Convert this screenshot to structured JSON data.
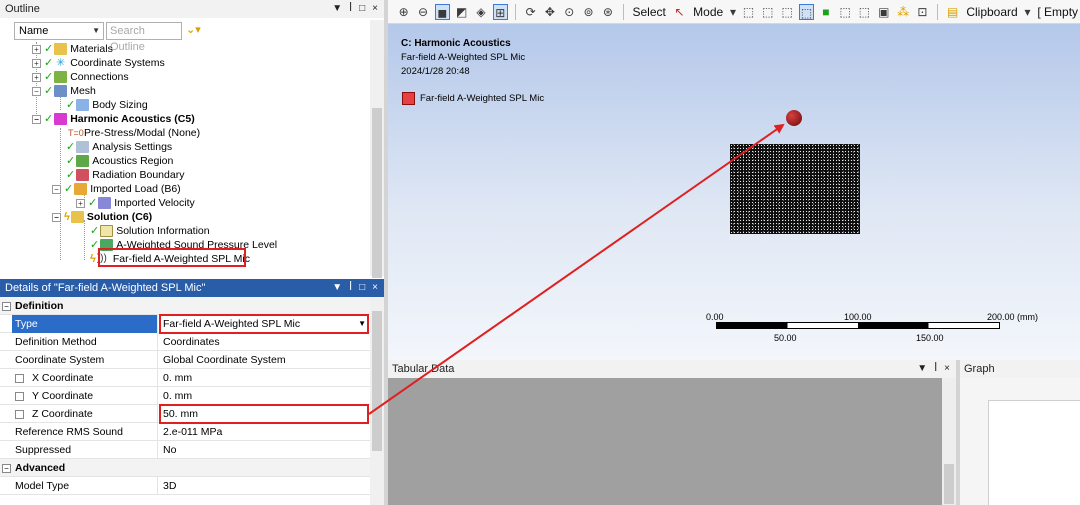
{
  "colors": {
    "accent": "#2a5da8",
    "selection": "#2a6cc8",
    "annotation": "#e02020",
    "ok_check": "#18a318"
  },
  "outline": {
    "title": "Outline",
    "name_select": "Name",
    "search_placeholder": "Search Outline",
    "tree": [
      {
        "label": "Materials",
        "icon": "materials-icon"
      },
      {
        "label": "Coordinate Systems",
        "icon": "coordinate-systems-icon"
      },
      {
        "label": "Connections",
        "icon": "connections-icon"
      },
      {
        "label": "Mesh",
        "icon": "mesh-icon"
      },
      {
        "label": "Body Sizing",
        "icon": "body-sizing-icon"
      },
      {
        "label": "Harmonic Acoustics (C5)",
        "icon": "harmonic-acoustics-icon"
      },
      {
        "label": "Pre-Stress/Modal (None)",
        "icon": "pre-stress-icon"
      },
      {
        "label": "Analysis Settings",
        "icon": "analysis-settings-icon"
      },
      {
        "label": "Acoustics Region",
        "icon": "acoustics-region-icon"
      },
      {
        "label": "Radiation Boundary",
        "icon": "radiation-boundary-icon"
      },
      {
        "label": "Imported Load (B6)",
        "icon": "imported-load-icon"
      },
      {
        "label": "Imported Velocity",
        "icon": "imported-velocity-icon"
      },
      {
        "label": "Solution (C6)",
        "icon": "solution-icon"
      },
      {
        "label": "Solution Information",
        "icon": "solution-information-icon"
      },
      {
        "label": "A-Weighted Sound Pressure Level",
        "icon": "sound-pressure-icon"
      },
      {
        "label": "Far-field A-Weighted SPL Mic",
        "icon": "mic-icon"
      }
    ]
  },
  "details": {
    "title": "Details of \"Far-field A-Weighted SPL Mic\"",
    "sections": {
      "definition": "Definition",
      "advanced": "Advanced"
    },
    "rows": {
      "type": {
        "label": "Type",
        "value": "Far-field A-Weighted SPL Mic"
      },
      "definition_method": {
        "label": "Definition Method",
        "value": "Coordinates"
      },
      "coordinate_system": {
        "label": "Coordinate System",
        "value": "Global Coordinate System"
      },
      "x_coordinate": {
        "label": "X Coordinate",
        "value": "0. mm"
      },
      "y_coordinate": {
        "label": "Y Coordinate",
        "value": "0. mm"
      },
      "z_coordinate": {
        "label": "Z Coordinate",
        "value": "50. mm"
      },
      "reference_rms": {
        "label": "Reference RMS Sound Pressure",
        "value": "2.e-011 MPa"
      },
      "suppressed": {
        "label": "Suppressed",
        "value": "No"
      },
      "model_type": {
        "label": "Model Type",
        "value": "3D"
      }
    }
  },
  "toolbar": {
    "select_label": "Select",
    "mode_label": "Mode",
    "clipboard_label": "Clipboard",
    "empty_label": "[ Empty"
  },
  "viewport": {
    "title": "C: Harmonic Acoustics",
    "subtitle": "Far-field A-Weighted SPL Mic",
    "date": "2024/1/28 20:48",
    "legend_label": "Far-field A-Weighted SPL Mic",
    "legend_color": "#e64040",
    "scale": {
      "top_labels": [
        "0.00",
        "100.00",
        "200.00 (mm)"
      ],
      "bottom_labels": [
        "50.00",
        "150.00"
      ]
    }
  },
  "tabular": {
    "title": "Tabular Data"
  },
  "graph": {
    "title": "Graph"
  },
  "pane_tools": {
    "pin": "▼",
    "pushpin": "ꟾ",
    "restore": "□",
    "close": "×"
  }
}
